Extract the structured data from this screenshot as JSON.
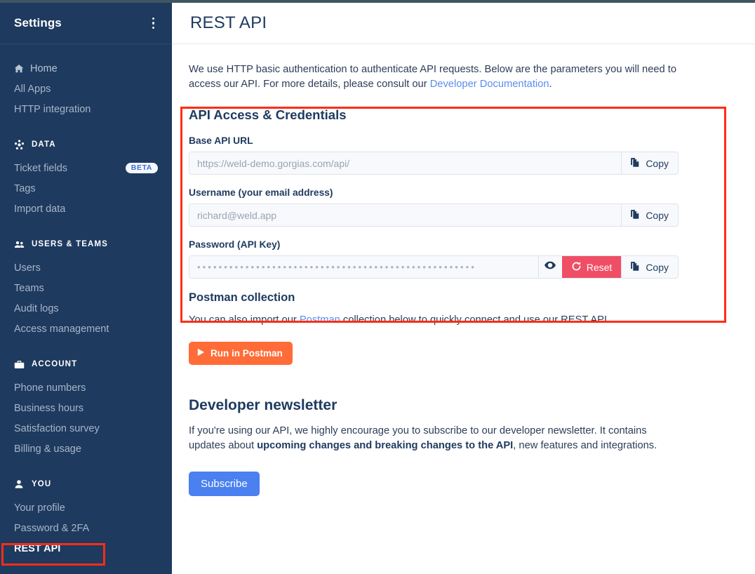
{
  "sidebar": {
    "title": "Settings",
    "menu_icon": "kebab-menu-icon",
    "top_items": [
      {
        "label": "Home",
        "icon": "home-icon"
      },
      {
        "label": "All Apps",
        "icon": ""
      },
      {
        "label": "HTTP integration",
        "icon": ""
      }
    ],
    "sections": [
      {
        "label": "DATA",
        "icon": "data-hub-icon",
        "items": [
          {
            "label": "Ticket fields",
            "badge": "BETA"
          },
          {
            "label": "Tags",
            "badge": ""
          },
          {
            "label": "Import data",
            "badge": ""
          }
        ]
      },
      {
        "label": "USERS & TEAMS",
        "icon": "users-icon",
        "items": [
          {
            "label": "Users",
            "badge": ""
          },
          {
            "label": "Teams",
            "badge": ""
          },
          {
            "label": "Audit logs",
            "badge": ""
          },
          {
            "label": "Access management",
            "badge": ""
          }
        ]
      },
      {
        "label": "ACCOUNT",
        "icon": "briefcase-icon",
        "items": [
          {
            "label": "Phone numbers",
            "badge": ""
          },
          {
            "label": "Business hours",
            "badge": ""
          },
          {
            "label": "Satisfaction survey",
            "badge": ""
          },
          {
            "label": "Billing & usage",
            "badge": ""
          }
        ]
      },
      {
        "label": "YOU",
        "icon": "person-icon",
        "items": [
          {
            "label": "Your profile",
            "badge": ""
          },
          {
            "label": "Password & 2FA",
            "badge": ""
          },
          {
            "label": "REST API",
            "badge": "",
            "active": true
          }
        ]
      }
    ]
  },
  "header": {
    "title": "REST API"
  },
  "intro": {
    "text_before": "We use HTTP basic authentication to authenticate API requests. Below are the parameters you will need to access our API. For more details, please consult our ",
    "link": "Developer Documentation",
    "text_after": "."
  },
  "credentials": {
    "title": "API Access & Credentials",
    "fields": [
      {
        "label": "Base API URL",
        "value": "https://weld-demo.gorgias.com/api/",
        "type": "text",
        "copy_label": "Copy"
      },
      {
        "label": "Username (your email address)",
        "value": "richard@weld.app",
        "type": "text",
        "copy_label": "Copy"
      },
      {
        "label": "Password (API Key)",
        "value": "••••••••••••••••••••••••••••••••••••••••••••••••••••",
        "type": "password",
        "reveal_icon": "eye-icon",
        "reset_label": "Reset",
        "reset_icon": "refresh-icon",
        "copy_label": "Copy"
      }
    ]
  },
  "postman": {
    "title": "Postman collection",
    "text_before": "You can also import our ",
    "link": "Postman",
    "text_after": " collection below to quickly connect and use our REST API.",
    "button_label": "Run in Postman",
    "button_icon": "play-icon"
  },
  "newsletter": {
    "title": "Developer newsletter",
    "text_before": "If you're using our API, we highly encourage you to subscribe to our developer newsletter. It contains updates about ",
    "bold": "upcoming changes and breaking changes to the API",
    "text_after": ", new features and integrations.",
    "button_label": "Subscribe"
  },
  "colors": {
    "sidebar_bg": "#1e3a5f",
    "accent_blue": "#4a80f0",
    "link_blue": "#5b8def",
    "reset_red": "#ef4e66",
    "postman_orange": "#ff6c37",
    "highlight_red": "#ff2d16"
  }
}
